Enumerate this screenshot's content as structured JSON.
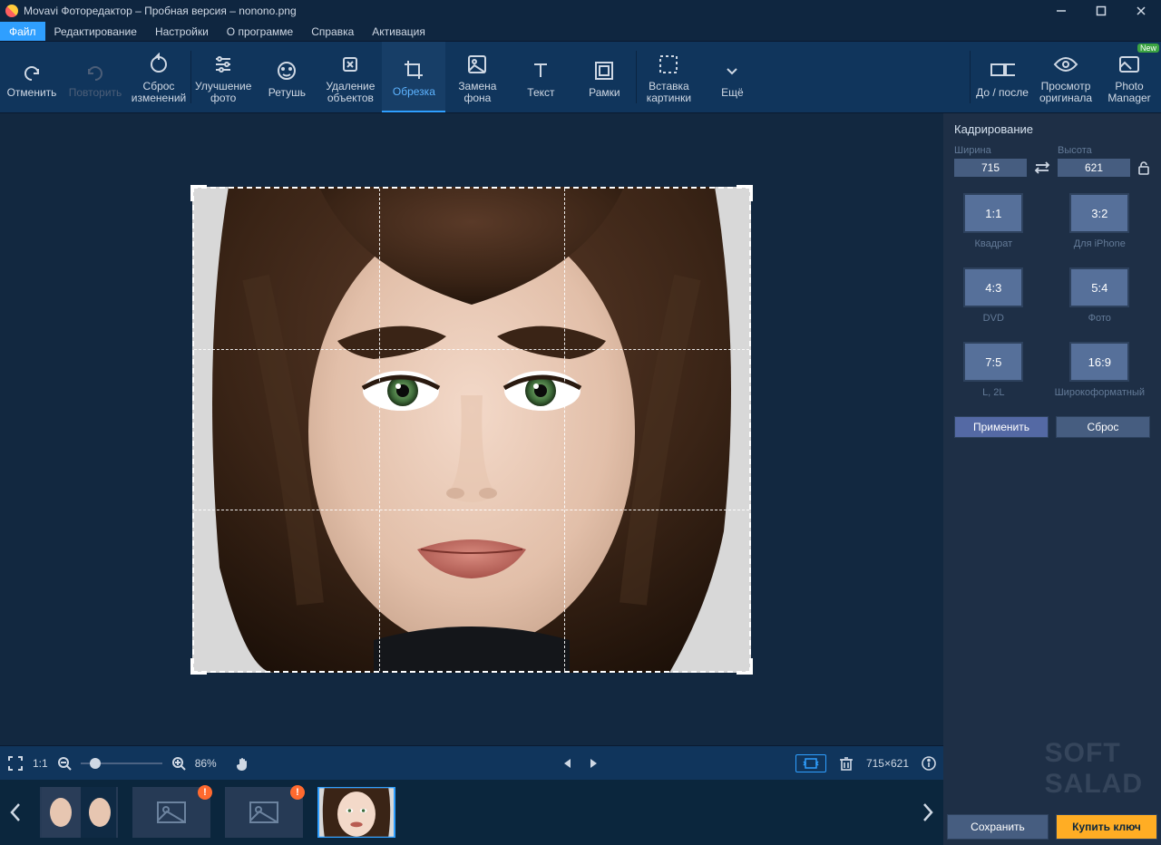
{
  "title": "Movavi Фоторедактор – Пробная версия – nonono.png",
  "menu": {
    "file": "Файл",
    "edit": "Редактирование",
    "settings": "Настройки",
    "about": "О программе",
    "help": "Справка",
    "activation": "Активация"
  },
  "toolbar": {
    "undo": "Отменить",
    "redo": "Повторить",
    "reset": "Сброс\nизменений",
    "enhance": "Улучшение\nфото",
    "retouch": "Ретушь",
    "remove": "Удаление\nобъектов",
    "crop": "Обрезка",
    "bgswap": "Замена\nфона",
    "text": "Текст",
    "frames": "Рамки",
    "insert": "Вставка\nкартинки",
    "more": "Ещё",
    "before": "До / после",
    "original": "Просмотр\nоригинала",
    "manager": "Photo\nManager",
    "new_badge": "New"
  },
  "panel": {
    "title": "Кадрирование",
    "width_label": "Ширина",
    "width_value": "715",
    "height_label": "Высота",
    "height_value": "621",
    "ratios": [
      {
        "r": "1:1",
        "l": "Квадрат"
      },
      {
        "r": "3:2",
        "l": "Для iPhone"
      },
      {
        "r": "4:3",
        "l": "DVD"
      },
      {
        "r": "5:4",
        "l": "Фото"
      },
      {
        "r": "7:5",
        "l": "L, 2L"
      },
      {
        "r": "16:9",
        "l": "Широкоформатный"
      }
    ],
    "apply": "Применить",
    "reset": "Сброс"
  },
  "footer": {
    "zoom": "86%",
    "fit": "1:1",
    "dims": "715×621"
  },
  "actions": {
    "save": "Сохранить",
    "buy": "Купить ключ"
  }
}
